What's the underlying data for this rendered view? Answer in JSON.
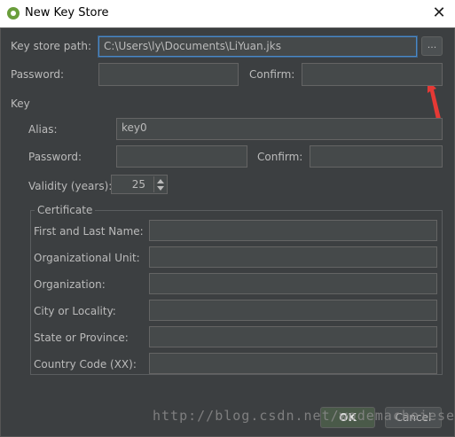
{
  "window": {
    "title": "New Key Store",
    "close_label": "✕"
  },
  "keystore": {
    "path_label": "Key store path:",
    "path_value": "C:\\Users\\ly\\Documents\\LiYuan.jks",
    "browse_label": "...",
    "password_label": "Password:",
    "password_value": "",
    "confirm_label": "Confirm:",
    "confirm_value": ""
  },
  "key": {
    "section_label": "Key",
    "alias_label": "Alias:",
    "alias_value": "key0",
    "password_label": "Password:",
    "password_value": "",
    "confirm_label": "Confirm:",
    "confirm_value": "",
    "validity_label": "Validity (years):",
    "validity_value": "25"
  },
  "certificate": {
    "section_label": "Certificate",
    "fields": [
      {
        "label": "First and Last Name:",
        "value": ""
      },
      {
        "label": "Organizational Unit:",
        "value": ""
      },
      {
        "label": "Organization:",
        "value": ""
      },
      {
        "label": "City or Locality:",
        "value": ""
      },
      {
        "label": "State or Province:",
        "value": ""
      },
      {
        "label": "Country Code (XX):",
        "value": ""
      }
    ]
  },
  "buttons": {
    "ok_label": "OK",
    "cancel_label": "Cancel"
  },
  "watermark": "http://blog.csdn.net/wodemacheiese",
  "colors": {
    "background": "#3c3f41",
    "field_bg": "#45494a",
    "focus_border": "#4a88c7",
    "annotation_arrow": "#e53935"
  }
}
